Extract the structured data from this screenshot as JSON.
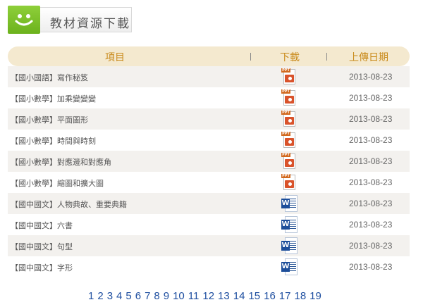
{
  "header": {
    "title": "教材資源下載",
    "icon": "smiley-icon"
  },
  "table": {
    "columns": {
      "item": "項目",
      "download": "下載",
      "date": "上傳日期"
    },
    "rows": [
      {
        "item": "【國小國語】寫作秘笈",
        "type": "ppt",
        "date": "2013-08-23"
      },
      {
        "item": "【國小數學】加乘變變變",
        "type": "ppt",
        "date": "2013-08-23"
      },
      {
        "item": "【國小數學】平面圖形",
        "type": "ppt",
        "date": "2013-08-23"
      },
      {
        "item": "【國小數學】時間與時刻",
        "type": "ppt",
        "date": "2013-08-23"
      },
      {
        "item": "【國小數學】對應邊和對應角",
        "type": "ppt",
        "date": "2013-08-23"
      },
      {
        "item": "【國小數學】縮圖和擴大圖",
        "type": "ppt",
        "date": "2013-08-23"
      },
      {
        "item": "【國中國文】人物典故、重要典籍",
        "type": "doc",
        "date": "2013-08-23"
      },
      {
        "item": "【國中國文】六書",
        "type": "doc",
        "date": "2013-08-23"
      },
      {
        "item": "【國中國文】句型",
        "type": "doc",
        "date": "2013-08-23"
      },
      {
        "item": "【國中國文】字形",
        "type": "doc",
        "date": "2013-08-23"
      }
    ]
  },
  "icons": {
    "ppt_tag": "PPT",
    "doc_letter": "W"
  },
  "pagination": [
    "1",
    "2",
    "3",
    "4",
    "5",
    "6",
    "7",
    "8",
    "9",
    "10",
    "11",
    "12",
    "13",
    "14",
    "15",
    "16",
    "17",
    "18",
    "19"
  ],
  "colors": {
    "header_bg": "#f4e9cf",
    "header_text": "#c98a1a",
    "link": "#1f4fa0",
    "accent_green": "#7cc12a"
  }
}
